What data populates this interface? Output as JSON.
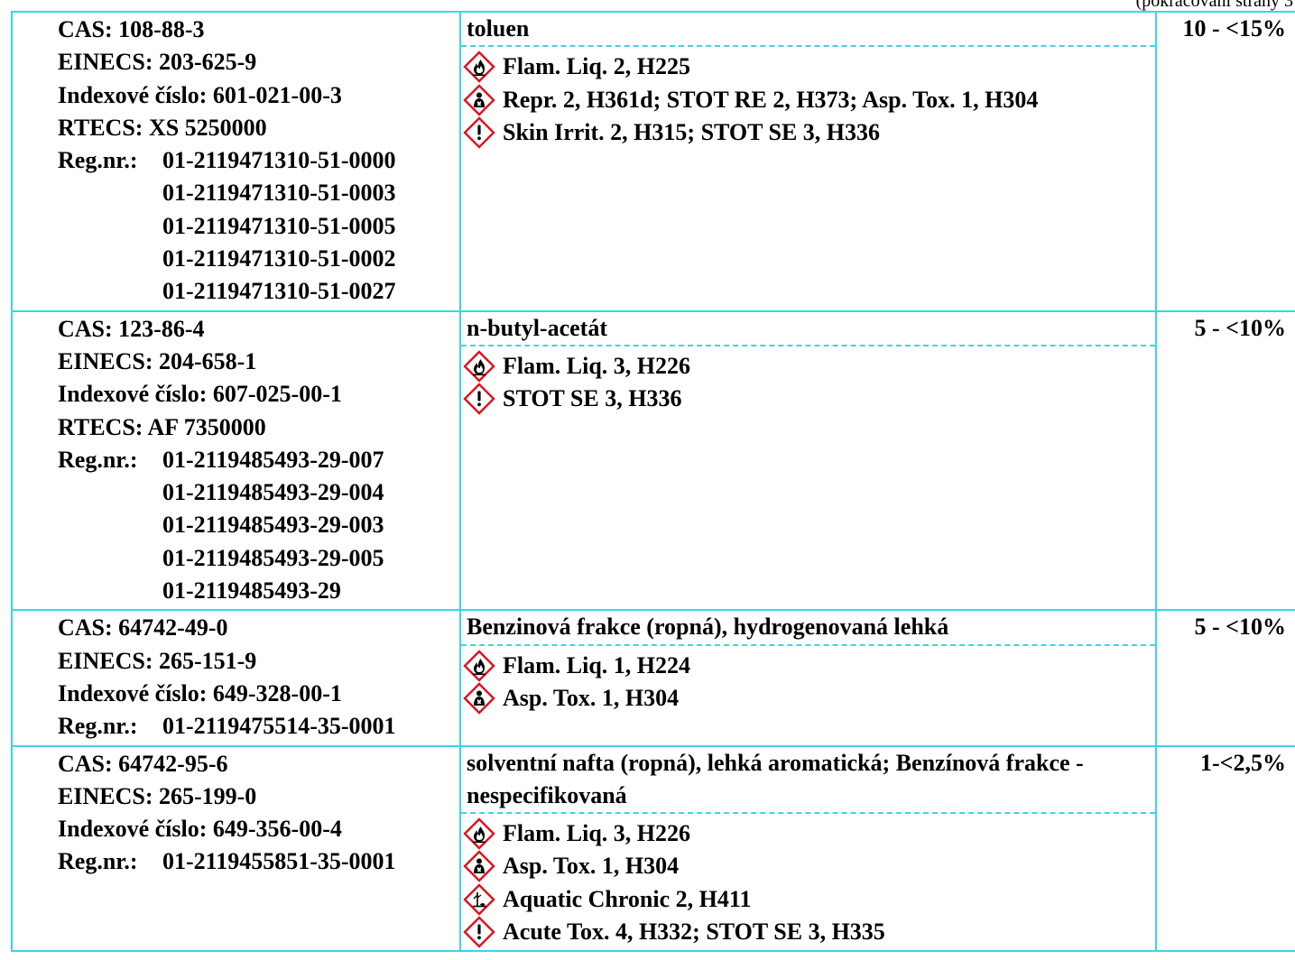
{
  "continuation": "(pokračování strany 3",
  "components": [
    {
      "identifiers": [
        {
          "text": "CAS: 108-88-3"
        },
        {
          "text": "EINECS: 203-625-9"
        },
        {
          "text": "Indexové číslo: 601-021-00-3"
        },
        {
          "text": "RTECS: XS 5250000"
        }
      ],
      "reg_label": "Reg.nr.:",
      "reg_numbers": [
        "01-2119471310-51-0000",
        "01-2119471310-51-0003",
        "01-2119471310-51-0005",
        "01-2119471310-51-0002",
        "01-2119471310-51-0027"
      ],
      "name": "toluen",
      "hazards": [
        {
          "icon": "flame-icon",
          "text": "Flam. Liq. 2, H225"
        },
        {
          "icon": "health-hazard-icon",
          "text": "Repr. 2, H361d; STOT RE 2, H373; Asp. Tox. 1, H304"
        },
        {
          "icon": "exclamation-icon",
          "text": "Skin Irrit. 2, H315; STOT SE 3, H336"
        }
      ],
      "concentration": "10 - <15%"
    },
    {
      "identifiers": [
        {
          "text": "CAS: 123-86-4"
        },
        {
          "text": "EINECS: 204-658-1"
        },
        {
          "text": "Indexové číslo: 607-025-00-1"
        },
        {
          "text": "RTECS: AF 7350000"
        }
      ],
      "reg_label": "Reg.nr.:",
      "reg_numbers": [
        "01-2119485493-29-007",
        "01-2119485493-29-004",
        "01-2119485493-29-003",
        "01-2119485493-29-005",
        "01-2119485493-29"
      ],
      "name": "n-butyl-acetát",
      "hazards": [
        {
          "icon": "flame-icon",
          "text": "Flam. Liq. 3, H226"
        },
        {
          "icon": "exclamation-icon",
          "text": "STOT SE 3, H336"
        }
      ],
      "concentration": "5 - <10%"
    },
    {
      "identifiers": [
        {
          "text": "CAS: 64742-49-0"
        },
        {
          "text": "EINECS: 265-151-9"
        },
        {
          "text": "Indexové číslo: 649-328-00-1"
        }
      ],
      "reg_label": "Reg.nr.:",
      "reg_numbers": [
        "01-2119475514-35-0001"
      ],
      "name": "Benzinová frakce (ropná), hydrogenovaná lehká",
      "hazards": [
        {
          "icon": "flame-icon",
          "text": "Flam. Liq. 1, H224"
        },
        {
          "icon": "health-hazard-icon",
          "text": "Asp. Tox. 1, H304"
        }
      ],
      "concentration": "5 - <10%"
    },
    {
      "identifiers": [
        {
          "text": "CAS: 64742-95-6"
        },
        {
          "text": "EINECS: 265-199-0"
        },
        {
          "text": "Indexové číslo: 649-356-00-4"
        }
      ],
      "reg_label": "Reg.nr.:",
      "reg_numbers": [
        "01-2119455851-35-0001"
      ],
      "name": "solventní nafta (ropná), lehká aromatická; Benzínová frakce - nespecifikovaná",
      "hazards": [
        {
          "icon": "flame-icon",
          "text": "Flam. Liq. 3, H226"
        },
        {
          "icon": "health-hazard-icon",
          "text": "Asp. Tox. 1, H304"
        },
        {
          "icon": "environment-icon",
          "text": "Aquatic Chronic 2, H411"
        },
        {
          "icon": "exclamation-icon",
          "text": "Acute Tox. 4, H332; STOT SE 3, H335"
        }
      ],
      "concentration": "1-<2,5%"
    }
  ],
  "colors": {
    "border": "#3ad6e6",
    "pictogram_border": "#e0101c"
  }
}
